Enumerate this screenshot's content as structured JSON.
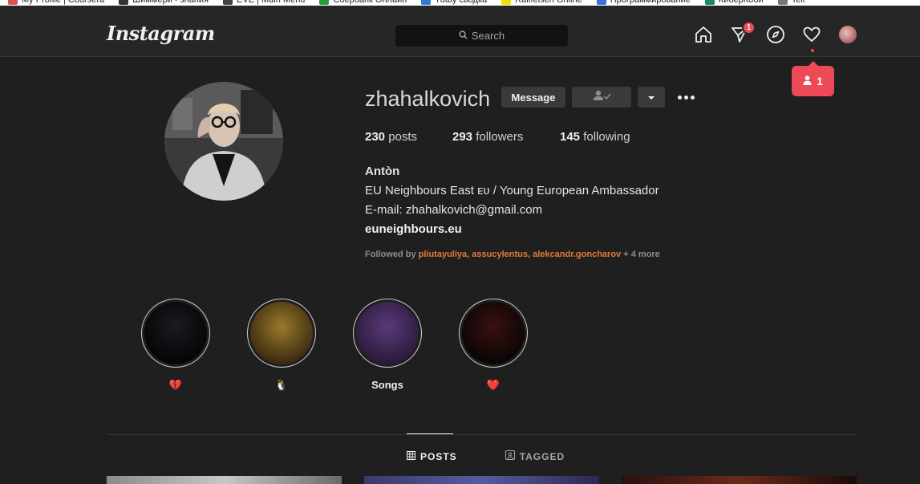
{
  "bookmarks": [
    {
      "label": "My Profile | Coursera",
      "color": "#d9534f"
    },
    {
      "label": "Шиммери - знания",
      "color": "#333333"
    },
    {
      "label": "EVE | Main Menu",
      "color": "#444444"
    },
    {
      "label": "Сбербанк Онлайн",
      "color": "#21a038"
    },
    {
      "label": "Tutby сводка",
      "color": "#2e7bd6"
    },
    {
      "label": "Raiffeisen Online",
      "color": "#f0e000"
    },
    {
      "label": "Программирование",
      "color": "#3b6fd8"
    },
    {
      "label": "КиберКоби",
      "color": "#1a8a5a"
    },
    {
      "label": "Telr",
      "color": "#777777"
    }
  ],
  "header": {
    "logo": "Instagram",
    "search_placeholder": "Search",
    "direct_badge": "1",
    "notification_count": "1"
  },
  "profile": {
    "username": "zhahalkovich",
    "message_label": "Message",
    "stats": {
      "posts_count": "230",
      "posts_label": "posts",
      "followers_count": "293",
      "followers_label": "followers",
      "following_count": "145",
      "following_label": "following"
    },
    "bio": {
      "name": "Antòn",
      "line1": "EU Neighbours East ᴇᴜ / Young European Ambassador",
      "line2": "E-mail: zhahalkovich@gmail.com",
      "link": "euneighbours.eu"
    },
    "followed_by": {
      "prefix": "Followed by ",
      "users": [
        "pliutayuliya",
        "assucylentus",
        "alekcandr.goncharov"
      ],
      "sep": ", ",
      "suffix": " + 4 more"
    }
  },
  "highlights": [
    {
      "label": "💔",
      "color_a": "#1a1a22",
      "color_b": "#050505"
    },
    {
      "label": "🐧",
      "color_a": "#9a7a2a",
      "color_b": "#3a2a10"
    },
    {
      "label": "Songs",
      "color_a": "#5a3a7a",
      "color_b": "#2a1a3a"
    },
    {
      "label": "❤️",
      "color_a": "#3a1010",
      "color_b": "#0a0505"
    }
  ],
  "tabs": [
    {
      "label": "POSTS",
      "active": true
    },
    {
      "label": "TAGGED",
      "active": false
    }
  ],
  "colors": {
    "accent_red": "#ed4956",
    "link_orange": "#e07a3a",
    "background": "#1f1f1f",
    "navbar": "#262626"
  }
}
